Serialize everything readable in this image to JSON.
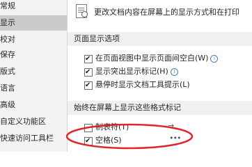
{
  "sidebar": {
    "items": [
      {
        "label": "常规",
        "selected": false
      },
      {
        "label": "显示",
        "selected": true
      },
      {
        "label": "校对",
        "selected": false
      },
      {
        "label": "保存",
        "selected": false
      },
      {
        "label": "版式",
        "selected": false
      },
      {
        "label": "语言",
        "selected": false
      },
      {
        "label": "高级",
        "selected": false
      },
      {
        "label": "自定义功能区",
        "selected": false
      },
      {
        "label": "快速访问工具栏",
        "selected": false
      }
    ]
  },
  "main": {
    "description": "更改文档内容在屏幕上的显示方式和在打印",
    "page_display_section": "页面显示选项",
    "page_display_options": [
      {
        "label": "在页面视图中显示页面间空白(W)",
        "checked": true,
        "info": true
      },
      {
        "label": "显示突出显示标记(H)",
        "checked": true,
        "info": true
      },
      {
        "label": "悬停时显示文档工具提示(L)",
        "checked": true,
        "info": false
      }
    ],
    "format_marks_section": "始终在屏幕上显示这些格式标记",
    "format_marks": [
      {
        "label": "制表符(T)",
        "checked": false,
        "symbol": "→"
      },
      {
        "label": "空格(S)",
        "checked": true,
        "symbol": "•••"
      }
    ]
  },
  "colors": {
    "highlight_oval": "#e0242b"
  }
}
